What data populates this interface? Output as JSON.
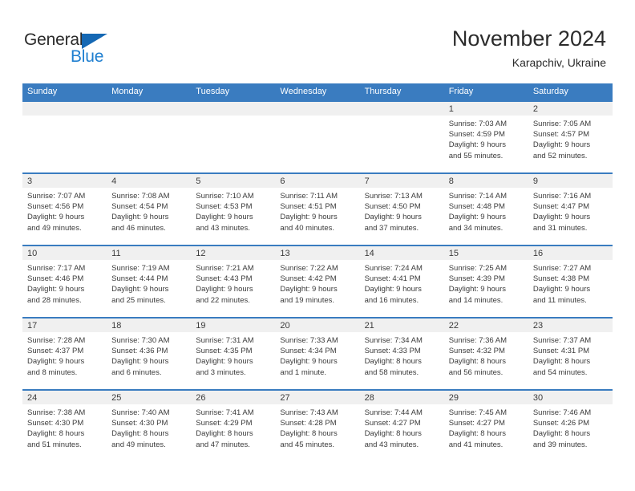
{
  "brand": {
    "name_part1": "General",
    "name_part2": "Blue",
    "triangle_icon": "triangle-icon",
    "accent_color": "#1568b4",
    "text_color": "#2b2b2b"
  },
  "header": {
    "title": "November 2024",
    "subtitle": "Karapchiv, Ukraine"
  },
  "calendar": {
    "header_bg": "#3a7cc0",
    "day_strip_bg": "#f0f0f0",
    "weekdays": [
      "Sunday",
      "Monday",
      "Tuesday",
      "Wednesday",
      "Thursday",
      "Friday",
      "Saturday"
    ],
    "weeks": [
      [
        {
          "day": "",
          "sunrise": "",
          "sunset": "",
          "daylight_line1": "",
          "daylight_line2": "",
          "empty": true
        },
        {
          "day": "",
          "sunrise": "",
          "sunset": "",
          "daylight_line1": "",
          "daylight_line2": "",
          "empty": true
        },
        {
          "day": "",
          "sunrise": "",
          "sunset": "",
          "daylight_line1": "",
          "daylight_line2": "",
          "empty": true
        },
        {
          "day": "",
          "sunrise": "",
          "sunset": "",
          "daylight_line1": "",
          "daylight_line2": "",
          "empty": true
        },
        {
          "day": "",
          "sunrise": "",
          "sunset": "",
          "daylight_line1": "",
          "daylight_line2": "",
          "empty": true
        },
        {
          "day": "1",
          "sunrise": "Sunrise: 7:03 AM",
          "sunset": "Sunset: 4:59 PM",
          "daylight_line1": "Daylight: 9 hours",
          "daylight_line2": "and 55 minutes.",
          "empty": false
        },
        {
          "day": "2",
          "sunrise": "Sunrise: 7:05 AM",
          "sunset": "Sunset: 4:57 PM",
          "daylight_line1": "Daylight: 9 hours",
          "daylight_line2": "and 52 minutes.",
          "empty": false
        }
      ],
      [
        {
          "day": "3",
          "sunrise": "Sunrise: 7:07 AM",
          "sunset": "Sunset: 4:56 PM",
          "daylight_line1": "Daylight: 9 hours",
          "daylight_line2": "and 49 minutes.",
          "empty": false
        },
        {
          "day": "4",
          "sunrise": "Sunrise: 7:08 AM",
          "sunset": "Sunset: 4:54 PM",
          "daylight_line1": "Daylight: 9 hours",
          "daylight_line2": "and 46 minutes.",
          "empty": false
        },
        {
          "day": "5",
          "sunrise": "Sunrise: 7:10 AM",
          "sunset": "Sunset: 4:53 PM",
          "daylight_line1": "Daylight: 9 hours",
          "daylight_line2": "and 43 minutes.",
          "empty": false
        },
        {
          "day": "6",
          "sunrise": "Sunrise: 7:11 AM",
          "sunset": "Sunset: 4:51 PM",
          "daylight_line1": "Daylight: 9 hours",
          "daylight_line2": "and 40 minutes.",
          "empty": false
        },
        {
          "day": "7",
          "sunrise": "Sunrise: 7:13 AM",
          "sunset": "Sunset: 4:50 PM",
          "daylight_line1": "Daylight: 9 hours",
          "daylight_line2": "and 37 minutes.",
          "empty": false
        },
        {
          "day": "8",
          "sunrise": "Sunrise: 7:14 AM",
          "sunset": "Sunset: 4:48 PM",
          "daylight_line1": "Daylight: 9 hours",
          "daylight_line2": "and 34 minutes.",
          "empty": false
        },
        {
          "day": "9",
          "sunrise": "Sunrise: 7:16 AM",
          "sunset": "Sunset: 4:47 PM",
          "daylight_line1": "Daylight: 9 hours",
          "daylight_line2": "and 31 minutes.",
          "empty": false
        }
      ],
      [
        {
          "day": "10",
          "sunrise": "Sunrise: 7:17 AM",
          "sunset": "Sunset: 4:46 PM",
          "daylight_line1": "Daylight: 9 hours",
          "daylight_line2": "and 28 minutes.",
          "empty": false
        },
        {
          "day": "11",
          "sunrise": "Sunrise: 7:19 AM",
          "sunset": "Sunset: 4:44 PM",
          "daylight_line1": "Daylight: 9 hours",
          "daylight_line2": "and 25 minutes.",
          "empty": false
        },
        {
          "day": "12",
          "sunrise": "Sunrise: 7:21 AM",
          "sunset": "Sunset: 4:43 PM",
          "daylight_line1": "Daylight: 9 hours",
          "daylight_line2": "and 22 minutes.",
          "empty": false
        },
        {
          "day": "13",
          "sunrise": "Sunrise: 7:22 AM",
          "sunset": "Sunset: 4:42 PM",
          "daylight_line1": "Daylight: 9 hours",
          "daylight_line2": "and 19 minutes.",
          "empty": false
        },
        {
          "day": "14",
          "sunrise": "Sunrise: 7:24 AM",
          "sunset": "Sunset: 4:41 PM",
          "daylight_line1": "Daylight: 9 hours",
          "daylight_line2": "and 16 minutes.",
          "empty": false
        },
        {
          "day": "15",
          "sunrise": "Sunrise: 7:25 AM",
          "sunset": "Sunset: 4:39 PM",
          "daylight_line1": "Daylight: 9 hours",
          "daylight_line2": "and 14 minutes.",
          "empty": false
        },
        {
          "day": "16",
          "sunrise": "Sunrise: 7:27 AM",
          "sunset": "Sunset: 4:38 PM",
          "daylight_line1": "Daylight: 9 hours",
          "daylight_line2": "and 11 minutes.",
          "empty": false
        }
      ],
      [
        {
          "day": "17",
          "sunrise": "Sunrise: 7:28 AM",
          "sunset": "Sunset: 4:37 PM",
          "daylight_line1": "Daylight: 9 hours",
          "daylight_line2": "and 8 minutes.",
          "empty": false
        },
        {
          "day": "18",
          "sunrise": "Sunrise: 7:30 AM",
          "sunset": "Sunset: 4:36 PM",
          "daylight_line1": "Daylight: 9 hours",
          "daylight_line2": "and 6 minutes.",
          "empty": false
        },
        {
          "day": "19",
          "sunrise": "Sunrise: 7:31 AM",
          "sunset": "Sunset: 4:35 PM",
          "daylight_line1": "Daylight: 9 hours",
          "daylight_line2": "and 3 minutes.",
          "empty": false
        },
        {
          "day": "20",
          "sunrise": "Sunrise: 7:33 AM",
          "sunset": "Sunset: 4:34 PM",
          "daylight_line1": "Daylight: 9 hours",
          "daylight_line2": "and 1 minute.",
          "empty": false
        },
        {
          "day": "21",
          "sunrise": "Sunrise: 7:34 AM",
          "sunset": "Sunset: 4:33 PM",
          "daylight_line1": "Daylight: 8 hours",
          "daylight_line2": "and 58 minutes.",
          "empty": false
        },
        {
          "day": "22",
          "sunrise": "Sunrise: 7:36 AM",
          "sunset": "Sunset: 4:32 PM",
          "daylight_line1": "Daylight: 8 hours",
          "daylight_line2": "and 56 minutes.",
          "empty": false
        },
        {
          "day": "23",
          "sunrise": "Sunrise: 7:37 AM",
          "sunset": "Sunset: 4:31 PM",
          "daylight_line1": "Daylight: 8 hours",
          "daylight_line2": "and 54 minutes.",
          "empty": false
        }
      ],
      [
        {
          "day": "24",
          "sunrise": "Sunrise: 7:38 AM",
          "sunset": "Sunset: 4:30 PM",
          "daylight_line1": "Daylight: 8 hours",
          "daylight_line2": "and 51 minutes.",
          "empty": false
        },
        {
          "day": "25",
          "sunrise": "Sunrise: 7:40 AM",
          "sunset": "Sunset: 4:30 PM",
          "daylight_line1": "Daylight: 8 hours",
          "daylight_line2": "and 49 minutes.",
          "empty": false
        },
        {
          "day": "26",
          "sunrise": "Sunrise: 7:41 AM",
          "sunset": "Sunset: 4:29 PM",
          "daylight_line1": "Daylight: 8 hours",
          "daylight_line2": "and 47 minutes.",
          "empty": false
        },
        {
          "day": "27",
          "sunrise": "Sunrise: 7:43 AM",
          "sunset": "Sunset: 4:28 PM",
          "daylight_line1": "Daylight: 8 hours",
          "daylight_line2": "and 45 minutes.",
          "empty": false
        },
        {
          "day": "28",
          "sunrise": "Sunrise: 7:44 AM",
          "sunset": "Sunset: 4:27 PM",
          "daylight_line1": "Daylight: 8 hours",
          "daylight_line2": "and 43 minutes.",
          "empty": false
        },
        {
          "day": "29",
          "sunrise": "Sunrise: 7:45 AM",
          "sunset": "Sunset: 4:27 PM",
          "daylight_line1": "Daylight: 8 hours",
          "daylight_line2": "and 41 minutes.",
          "empty": false
        },
        {
          "day": "30",
          "sunrise": "Sunrise: 7:46 AM",
          "sunset": "Sunset: 4:26 PM",
          "daylight_line1": "Daylight: 8 hours",
          "daylight_line2": "and 39 minutes.",
          "empty": false
        }
      ]
    ]
  }
}
